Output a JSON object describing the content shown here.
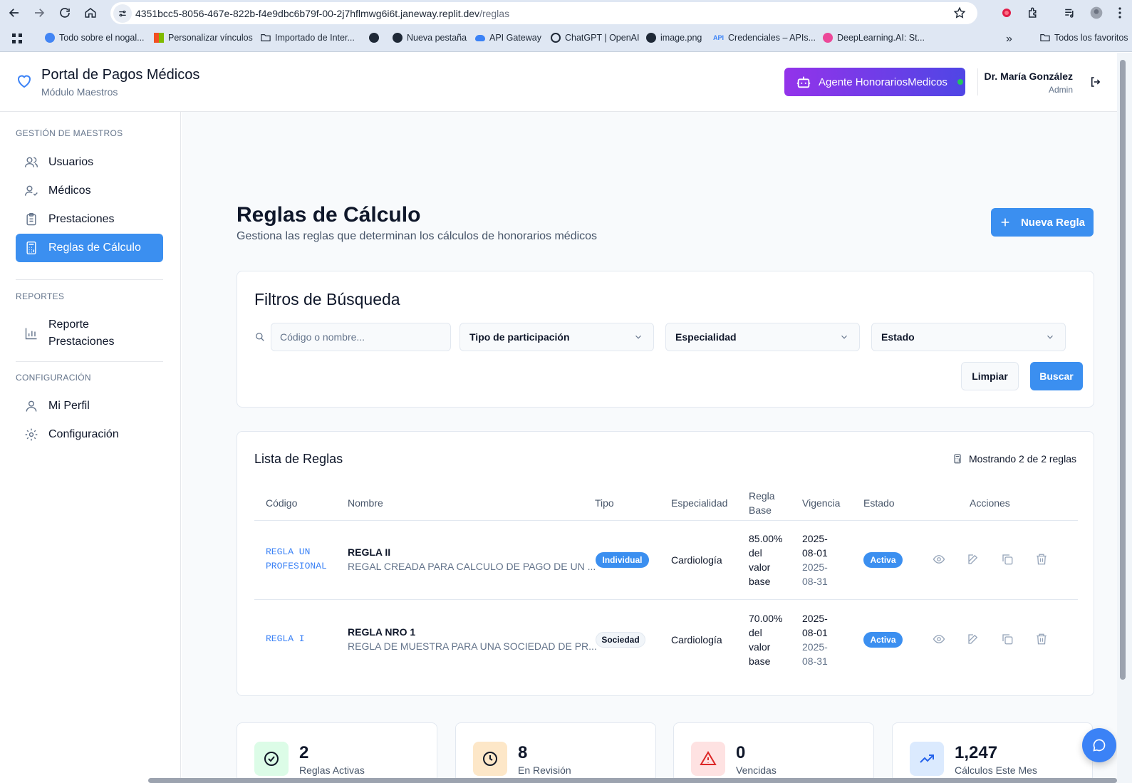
{
  "browser": {
    "url_host": "4351bcc5-8056-467e-822b-f4e9dbc6b79f-00-2j7hflmwg6i6t.janeway.replit.dev",
    "url_path": "/reglas",
    "bookmarks": [
      "Todo sobre el nogal...",
      "Personalizar vínculos",
      "Importado de Inter...",
      "Nueva pestaña",
      "API Gateway",
      "ChatGPT | OpenAI",
      "image.png",
      "Credenciales – APIs...",
      "DeepLearning.AI: St..."
    ],
    "all_bookmarks": "Todos los favoritos"
  },
  "header": {
    "title": "Portal de Pagos Médicos",
    "subtitle": "Módulo Maestros",
    "agent_button": "Agente HonorariosMedicos",
    "user_name": "Dr. María González",
    "user_role": "Admin"
  },
  "sidebar": {
    "section_masters": "GESTIÓN DE MAESTROS",
    "section_reports": "REPORTES",
    "section_config": "CONFIGURACIÓN",
    "items": [
      {
        "label": "Usuarios",
        "icon": "users-icon"
      },
      {
        "label": "Médicos",
        "icon": "user-check-icon"
      },
      {
        "label": "Prestaciones",
        "icon": "clipboard-icon"
      },
      {
        "label": "Reglas de Cálculo",
        "icon": "calculator-icon",
        "active": true
      },
      {
        "label": "Reporte Prestaciones",
        "icon": "bar-chart-icon"
      },
      {
        "label": "Mi Perfil",
        "icon": "user-icon"
      },
      {
        "label": "Configuración",
        "icon": "gear-icon"
      }
    ]
  },
  "page": {
    "title": "Reglas de Cálculo",
    "subtitle": "Gestiona las reglas que determinan los cálculos de honorarios médicos",
    "new_button": "Nueva Regla"
  },
  "filters": {
    "title": "Filtros de Búsqueda",
    "search_placeholder": "Código o nombre...",
    "type_select": "Tipo de participación",
    "specialty_select": "Especialidad",
    "status_select": "Estado",
    "clear_button": "Limpiar",
    "search_button": "Buscar"
  },
  "rules_list": {
    "title": "Lista de Reglas",
    "showing": "Mostrando 2 de 2 reglas",
    "columns": [
      "Código",
      "Nombre",
      "Tipo",
      "Especialidad",
      "Regla Base",
      "Vigencia",
      "Estado",
      "Acciones"
    ],
    "rows": [
      {
        "code": "REGLA UN PROFESIONAL",
        "name": "REGLA II",
        "description": "REGAL CREADA PARA CALCULO DE PAGO DE UN ...",
        "type": "Individual",
        "specialty": "Cardiología",
        "base_rule": "85.00% del valor base",
        "valid_from": "2025-08-01",
        "valid_to": "2025-08-31",
        "status": "Activa"
      },
      {
        "code": "REGLA I",
        "name": "REGLA NRO 1",
        "description": "REGLA DE MUESTRA PARA UNA SOCIEDAD DE PR...",
        "type": "Sociedad",
        "specialty": "Cardiología",
        "base_rule": "70.00% del valor base",
        "valid_from": "2025-08-01",
        "valid_to": "2025-08-31",
        "status": "Activa"
      }
    ]
  },
  "stats": [
    {
      "value": "2",
      "label": "Reglas Activas",
      "icon": "check-circle-icon",
      "color": "#16a34a",
      "bg": "#dcfce7"
    },
    {
      "value": "8",
      "label": "En Revisión",
      "icon": "clock-icon",
      "color": "#111827",
      "bg": "#fde7c8"
    },
    {
      "value": "0",
      "label": "Vencidas",
      "icon": "alert-triangle-icon",
      "color": "#dc2626",
      "bg": "#fee2e2"
    },
    {
      "value": "1,247",
      "label": "Cálculos Este Mes",
      "icon": "trending-up-icon",
      "color": "#2563eb",
      "bg": "#dbeafe"
    }
  ],
  "colors": {
    "primary": "#3b8ff0",
    "agent_gradient_start": "#9333ea",
    "agent_gradient_end": "#4f46e5"
  }
}
